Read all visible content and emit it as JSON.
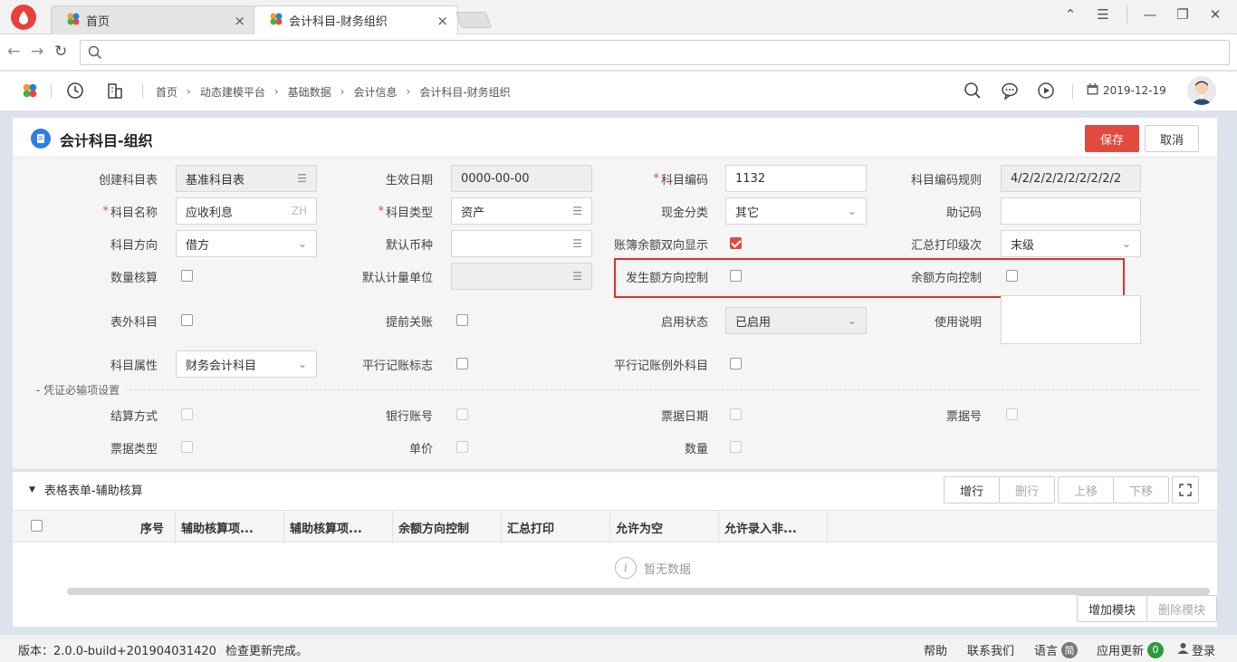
{
  "browser": {
    "tabs": [
      {
        "label": "首页",
        "close": "×"
      },
      {
        "label": "会计科目-财务组织",
        "close": "×"
      }
    ],
    "window_controls": [
      "⌃",
      "☰",
      "—",
      "❐",
      "✕"
    ],
    "nav": {
      "back": "←",
      "forward": "→",
      "reload": "↻"
    },
    "search_placeholder": ""
  },
  "header": {
    "breadcrumb": [
      "首页",
      "动态建模平台",
      "基础数据",
      "会计信息",
      "会计科目-财务组织"
    ],
    "breadcrumb_sep": "›",
    "date": "2019-12-19"
  },
  "page": {
    "title": "会计科目-组织",
    "save_label": "保存",
    "cancel_label": "取消"
  },
  "form": {
    "chart_table": {
      "label": "创建科目表",
      "value": "基准科目表"
    },
    "effective_date": {
      "label": "生效日期",
      "value": "0000-00-00"
    },
    "account_code": {
      "label": "科目编码",
      "value": "1132"
    },
    "code_rule": {
      "label": "科目编码规则",
      "value": "4/2/2/2/2/2/2/2/2/2"
    },
    "account_name": {
      "label": "科目名称",
      "value": "应收利息",
      "hint": "ZH"
    },
    "account_type": {
      "label": "科目类型",
      "value": "资产"
    },
    "cash_category": {
      "label": "现金分类",
      "value": "其它"
    },
    "mnemonic": {
      "label": "助记码",
      "value": ""
    },
    "direction": {
      "label": "科目方向",
      "value": "借方"
    },
    "default_currency": {
      "label": "默认币种",
      "value": ""
    },
    "dual_display": {
      "label": "账簿余额双向显示",
      "checked": true
    },
    "summary_level": {
      "label": "汇总打印级次",
      "value": "末级"
    },
    "quantity_calc": {
      "label": "数量核算",
      "checked": false
    },
    "default_unit": {
      "label": "默认计量单位",
      "value": ""
    },
    "amount_dir_ctrl": {
      "label": "发生额方向控制",
      "checked": false
    },
    "balance_dir_ctrl": {
      "label": "余额方向控制",
      "checked": false
    },
    "off_balance": {
      "label": "表外科目",
      "checked": false
    },
    "early_close": {
      "label": "提前关账",
      "checked": false
    },
    "enable_status": {
      "label": "启用状态",
      "value": "已启用"
    },
    "usage_note": {
      "label": "使用说明",
      "value": ""
    },
    "account_attr": {
      "label": "科目属性",
      "value": "财务会计科目"
    },
    "parallel_flag": {
      "label": "平行记账标志",
      "checked": false
    },
    "parallel_exception": {
      "label": "平行记账例外科目",
      "checked": false
    }
  },
  "voucher_section": {
    "title": "- 凭证必输项设置",
    "settle_method": "结算方式",
    "bank_account": "银行账号",
    "bill_date": "票据日期",
    "bill_no": "票据号",
    "bill_type": "票据类型",
    "unit_price": "单价",
    "quantity": "数量"
  },
  "grid": {
    "title": "表格表单-辅助核算",
    "toolbar": {
      "add_row": "增行",
      "delete_row": "删行",
      "move_up": "上移",
      "move_down": "下移"
    },
    "columns": [
      "序号",
      "辅助核算项...",
      "辅助核算项...",
      "余额方向控制",
      "汇总打印",
      "允许为空",
      "允许录入非..."
    ],
    "empty_text": "暂无数据",
    "add_module": "增加模块",
    "delete_module": "删除模块"
  },
  "statusbar": {
    "version": "版本：2.0.0-build+201904031420",
    "update_check": "检查更新完成。",
    "help": "帮助",
    "contact": "联系我们",
    "language": "语言",
    "language_badge": "简",
    "app_update": "应用更新",
    "update_count": "0",
    "login": "登录"
  },
  "colors": {
    "primary": "#e04a3f",
    "highlight_box": "#e0312b",
    "accent_blue": "#2d7ee0"
  }
}
